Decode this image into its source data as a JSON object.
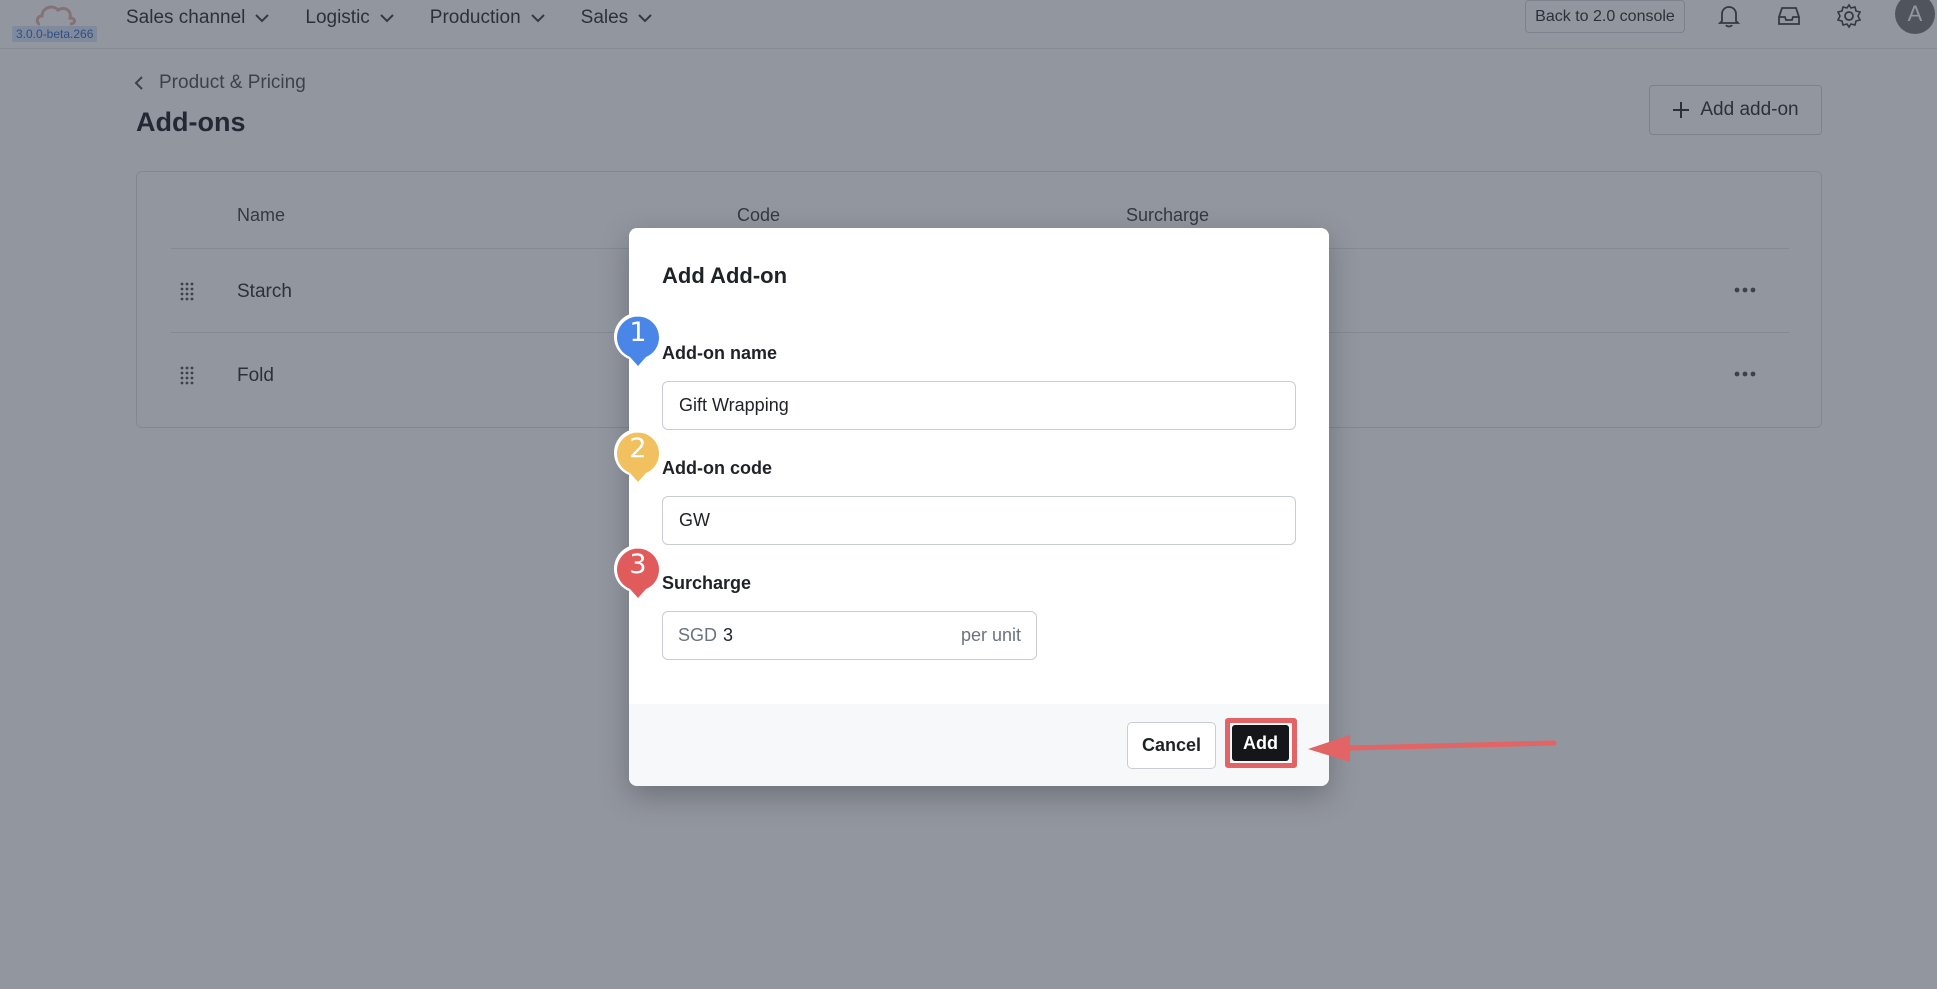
{
  "app": {
    "version": "3.0.0-beta.266"
  },
  "nav": {
    "items": [
      "Sales channel",
      "Logistic",
      "Production",
      "Sales"
    ],
    "console_button": "Back to 2.0 console",
    "avatar_initial": "A"
  },
  "page": {
    "breadcrumb": "Product & Pricing",
    "title": "Add-ons",
    "add_button": "Add add-on"
  },
  "table": {
    "columns": [
      "Name",
      "Code",
      "Surcharge"
    ],
    "rows": [
      {
        "name": "Starch"
      },
      {
        "name": "Fold"
      }
    ]
  },
  "modal": {
    "title": "Add Add-on",
    "name_label": "Add-on name",
    "name_value": "Gift Wrapping",
    "code_label": "Add-on code",
    "code_value": "GW",
    "surcharge_label": "Surcharge",
    "surcharge_currency": "SGD",
    "surcharge_value": "3",
    "surcharge_unit": "per unit",
    "cancel_label": "Cancel",
    "add_label": "Add"
  },
  "annotations": {
    "steps": [
      "1",
      "2",
      "3"
    ],
    "colors": {
      "step1": "#4a86e8",
      "step2": "#f1c05f",
      "step3": "#e05c5c",
      "highlight": "#e26464"
    }
  }
}
